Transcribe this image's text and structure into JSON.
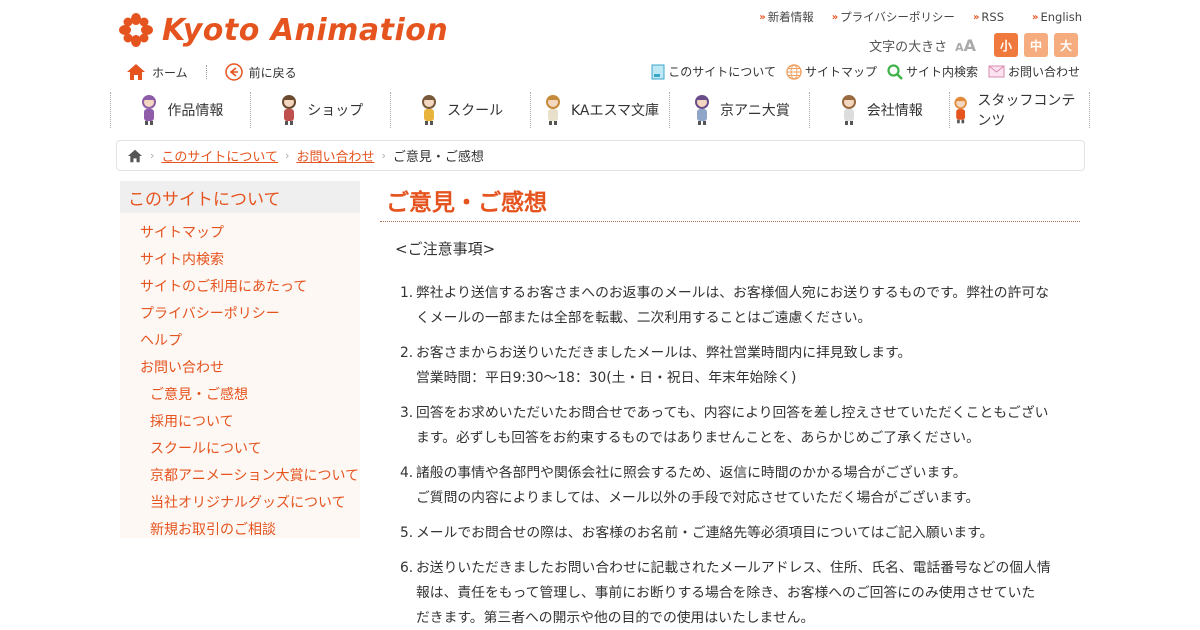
{
  "brand": {
    "logo_text": "Kyoto Animation",
    "color": "#e5541f"
  },
  "top_links": [
    {
      "label": "新着情報"
    },
    {
      "label": "プライバシーポリシー"
    },
    {
      "label": "RSS"
    },
    {
      "label": "English"
    }
  ],
  "font_size": {
    "label": "文字の大きさ",
    "aa_small": "A",
    "aa_large": "A",
    "buttons": [
      {
        "label": "小",
        "color": "#f07a3e"
      },
      {
        "label": "中",
        "color": "#f5ad7f"
      },
      {
        "label": "大",
        "color": "#f5ad7f"
      }
    ]
  },
  "util_left": [
    {
      "label": "ホーム",
      "icon": "home-icon"
    },
    {
      "label": "前に戻る",
      "icon": "back-arrow-icon"
    }
  ],
  "util_right": [
    {
      "label": "このサイトについて",
      "icon": "document-icon"
    },
    {
      "label": "サイトマップ",
      "icon": "globe-icon"
    },
    {
      "label": "サイト内検索",
      "icon": "search-icon"
    },
    {
      "label": "お問い合わせ",
      "icon": "mail-icon"
    }
  ],
  "main_nav": [
    {
      "label": "作品情報",
      "color": "#8e5ca8"
    },
    {
      "label": "ショップ",
      "color": "#6b4a2e"
    },
    {
      "label": "スクール",
      "color": "#7a5a3c"
    },
    {
      "label": "KAエスマ文庫",
      "color": "#c58a3a"
    },
    {
      "label": "京アニ大賞",
      "color": "#6a4c8a"
    },
    {
      "label": "会社情報",
      "color": "#9a6a40"
    },
    {
      "label": "スタッフコンテンツ",
      "color": "#e08a3a"
    }
  ],
  "breadcrumb": {
    "items": [
      "このサイトについて",
      "お問い合わせ"
    ],
    "current": "ご意見・ご感想"
  },
  "sidebar": {
    "heading": "このサイトについて",
    "items": [
      "サイトマップ",
      "サイト内検索",
      "サイトのご利用にあたって",
      "プライバシーポリシー",
      "ヘルプ",
      "お問い合わせ"
    ],
    "sub_items": [
      "ご意見・ご感想",
      "採用について",
      "スクールについて",
      "京都アニメーション大賞について",
      "当社オリジナルグッズについて",
      "新規お取引のご相談"
    ]
  },
  "main": {
    "title": "ご意見・ご感想",
    "notice_heading": "<ご注意事項>",
    "notes": [
      [
        "弊社より送信するお客さまへのお返事のメールは、お客様個人宛にお送りするものです。弊社の許可な",
        "くメールの一部または全部を転載、二次利用することはご遠慮ください。"
      ],
      [
        "お客さまからお送りいただきましたメールは、弊社営業時間内に拝見致します。",
        "営業時間：平日9:30～18：30(土・日・祝日、年末年始除く)"
      ],
      [
        "回答をお求めいただいたお問合せであっても、内容により回答を差し控えさせていただくこともござい",
        "ます。必ずしも回答をお約束するものではありませんことを、あらかじめご了承ください。"
      ],
      [
        "諸般の事情や各部門や関係会社に照会するため、返信に時間のかかる場合がございます。",
        "ご質問の内容によりましては、メール以外の手段で対応させていただく場合がございます。"
      ],
      [
        "メールでお問合せの際は、お客様のお名前・ご連絡先等必須項目についてはご記入願います。"
      ],
      [
        "お送りいただきましたお問い合わせに記載されたメールアドレス、住所、氏名、電話番号などの個人情",
        "報は、責任をもって管理し、事前にお断りする場合を除き、お客様へのご回答にのみ使用させていた",
        "だきます。第三者への開示や他の目的での使用はいたしません。"
      ]
    ]
  }
}
